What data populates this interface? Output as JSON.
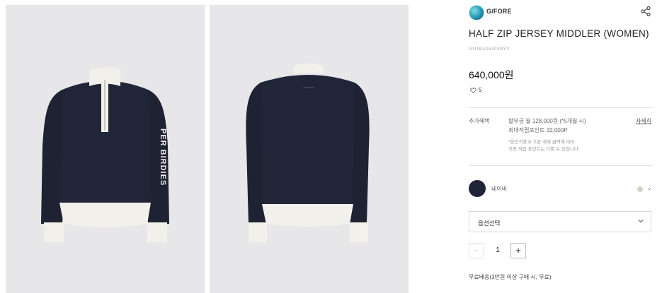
{
  "brand": {
    "name": "G/FORE",
    "logo_icon": "brand-logo",
    "share_icon": "share-icon"
  },
  "product": {
    "title": "HALF ZIP JERSEY MIDDLER (WOMEN)",
    "code": "GNTBA25303NYX",
    "price": "640,000원",
    "likes": "5"
  },
  "benefit": {
    "label": "추가혜택",
    "line1": "할부금 월 128,000원 (*5개월 시)",
    "line2": "최대적립포인트 32,000P",
    "note1": "*할인적용과 쿠폰 계제 금액에 따라",
    "note2": "최종 적립 포인트는 다를 수 있습니다.",
    "detail_link": "자세히"
  },
  "color": {
    "name": "네이비",
    "swatch_hex": "#1f2436",
    "alt_swatch_hex": "#d9d2c4"
  },
  "option": {
    "placeholder": "옵션선택"
  },
  "quantity": {
    "minus": "−",
    "value": "1",
    "plus": "+"
  },
  "shipping": "무료배송(3만원 이상 구매 시, 무료)",
  "images": [
    {
      "label": "front view",
      "text_on_sleeve": "PER BIRDIES"
    },
    {
      "label": "back view"
    }
  ]
}
